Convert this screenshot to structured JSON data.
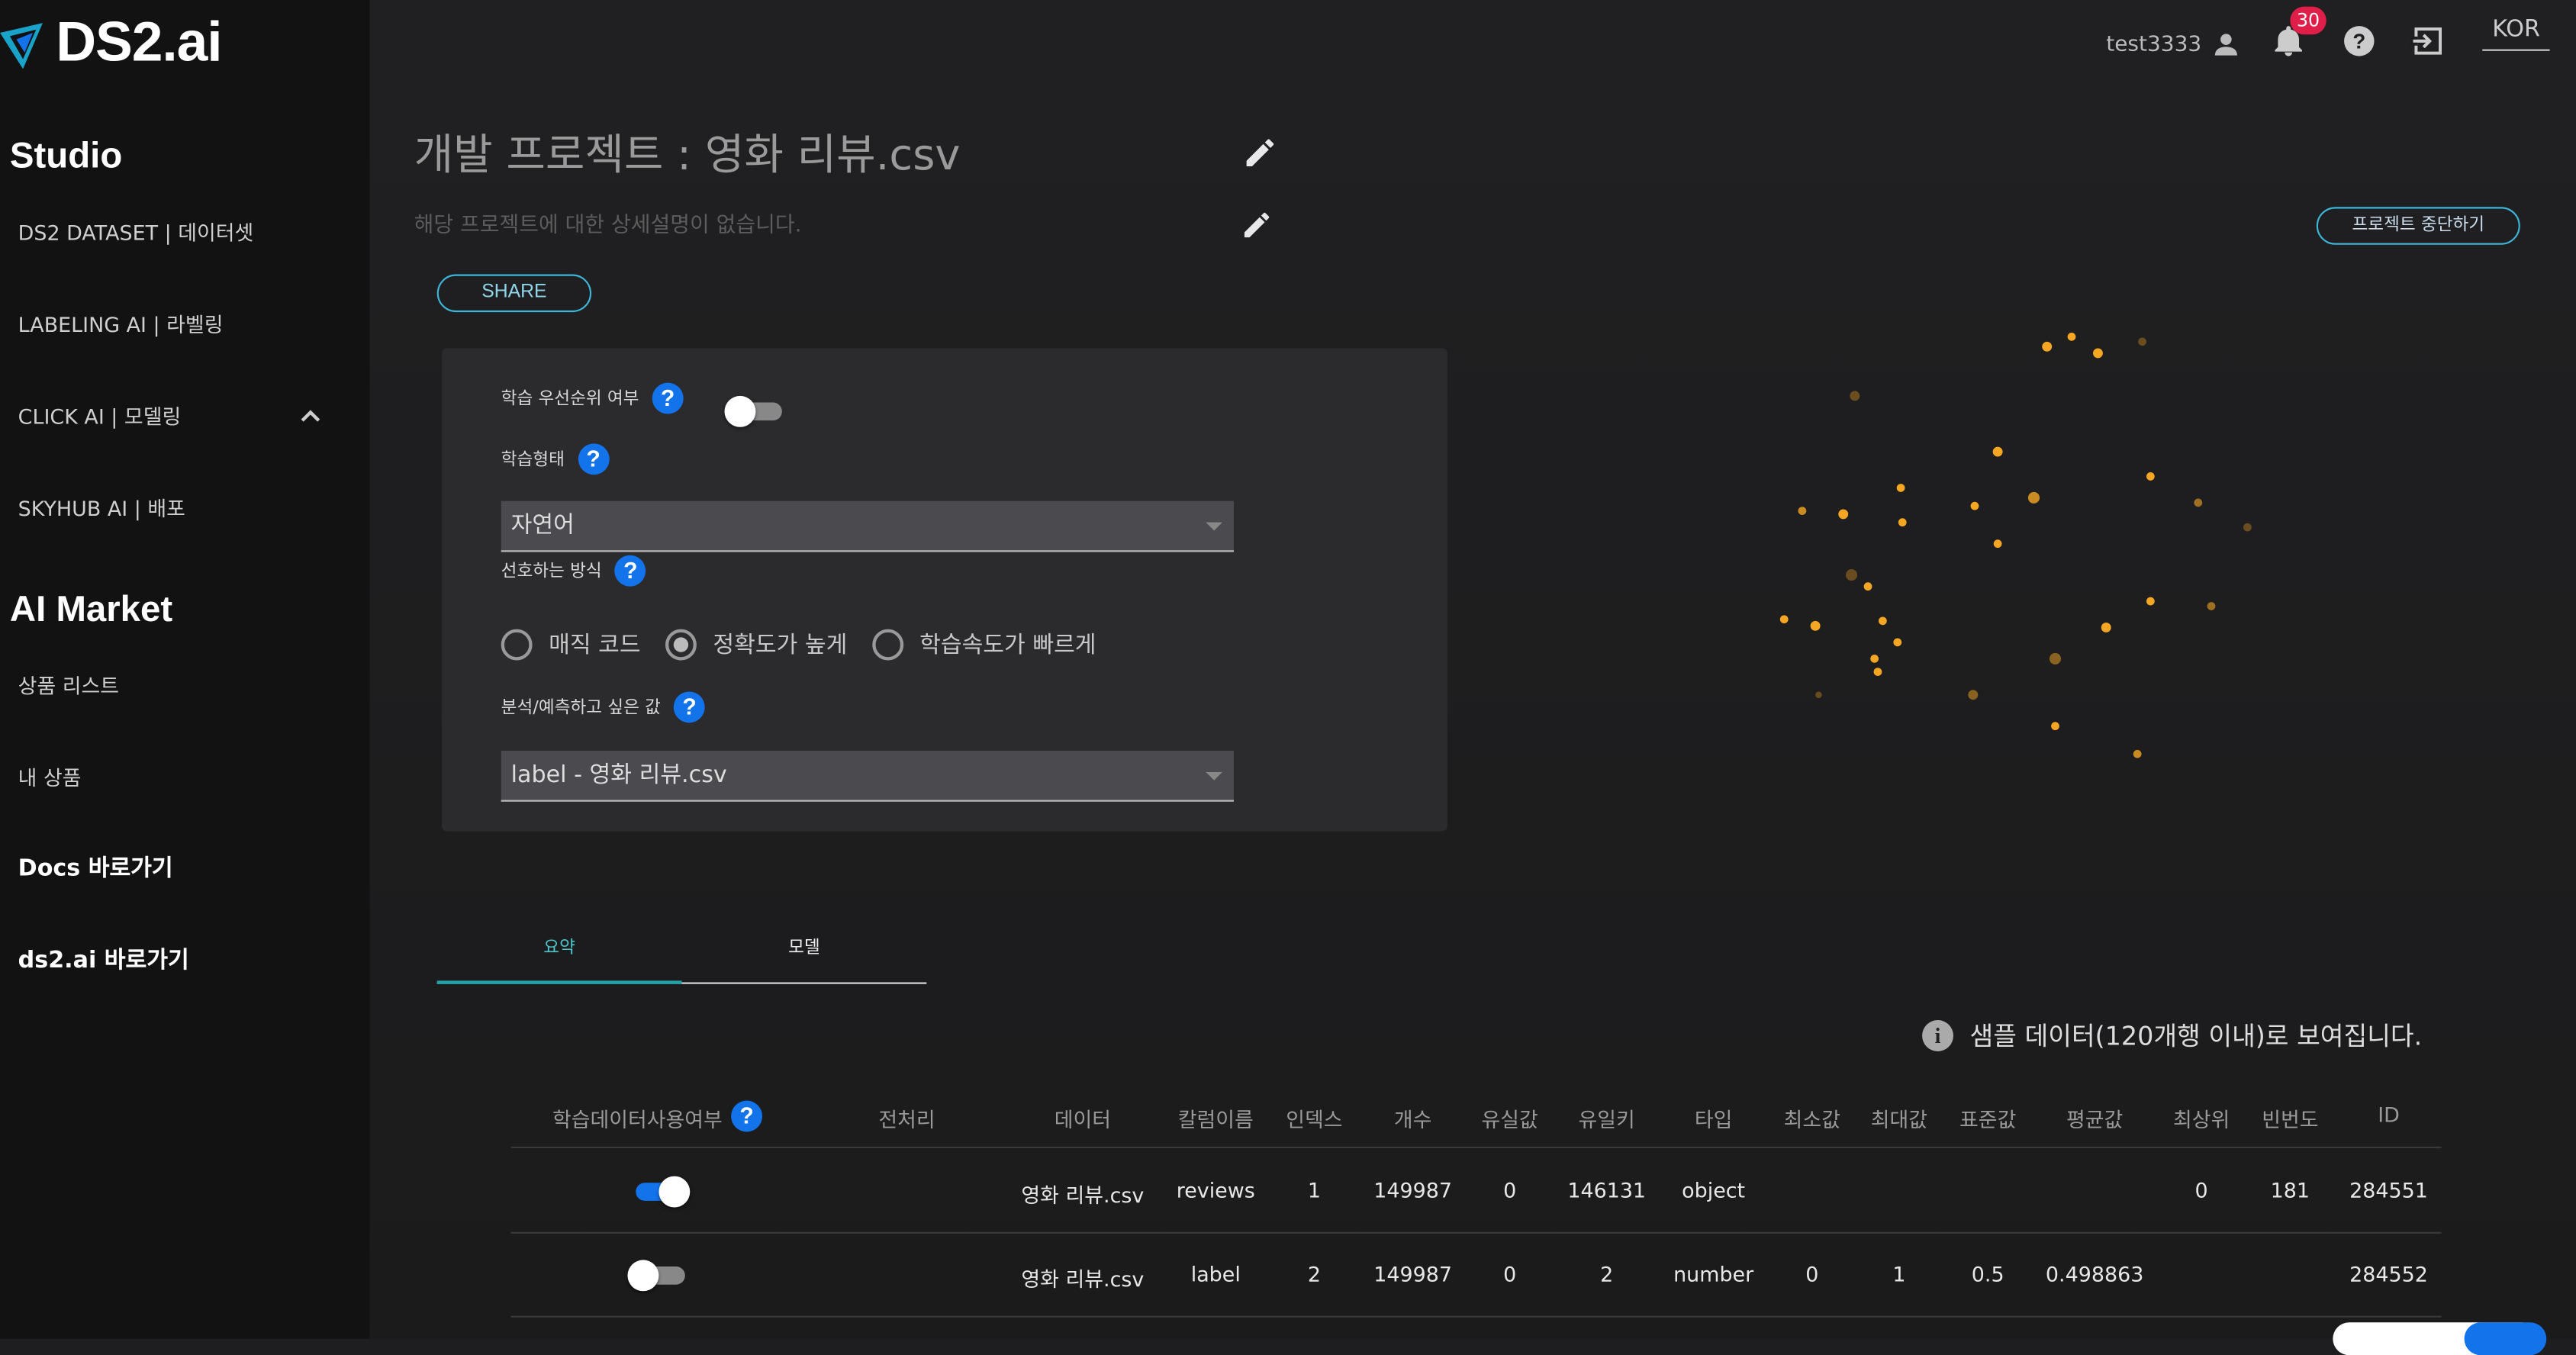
{
  "logo": {
    "text": "DS2.ai"
  },
  "sidebar": {
    "studio_title": "Studio",
    "studio_items": [
      {
        "label": "DS2 DATASET | 데이터셋"
      },
      {
        "label": "LABELING AI | 라벨링"
      },
      {
        "label": "CLICK AI | 모델링"
      },
      {
        "label": "SKYHUB AI | 배포"
      }
    ],
    "market_title": "AI Market",
    "market_items": [
      {
        "label": "상품 리스트"
      },
      {
        "label": "내 상품"
      }
    ],
    "links": [
      {
        "label": "Docs 바로가기"
      },
      {
        "label": "ds2.ai 바로가기"
      }
    ]
  },
  "header": {
    "username": "test3333",
    "notification_count": "30",
    "language": "KOR"
  },
  "project": {
    "title": "개발 프로젝트 : 영화 리뷰.csv",
    "description": "해당 프로젝트에 대한 상세설명이 없습니다.",
    "share_label": "SHARE",
    "stop_label": "프로젝트 중단하기"
  },
  "settings": {
    "priority_label": "학습 우선순위 여부",
    "priority_enabled": false,
    "train_type_label": "학습형태",
    "train_type_value": "자연어",
    "method_label": "선호하는 방식",
    "methods": [
      {
        "label": "매직 코드",
        "selected": false
      },
      {
        "label": "정확도가 높게",
        "selected": true
      },
      {
        "label": "학습속도가 빠르게",
        "selected": false
      }
    ],
    "target_label": "분석/예측하고 싶은 값",
    "target_value": "label - 영화 리뷰.csv",
    "help_glyph": "?"
  },
  "tabs": [
    {
      "label": "요약",
      "active": true
    },
    {
      "label": "모델",
      "active": false
    }
  ],
  "notice": {
    "text": "샘플 데이터(120개행 이내)로 보여집니다.",
    "icon_glyph": "i"
  },
  "table": {
    "headers": [
      "학습데이터사용여부",
      "전처리",
      "데이터",
      "칼럼이름",
      "인덱스",
      "개수",
      "유실값",
      "유일키",
      "타입",
      "최소값",
      "최대값",
      "표준값",
      "평균값",
      "최상위",
      "빈번도",
      "ID"
    ],
    "rows": [
      {
        "use": true,
        "preprocess": "",
        "data": "영화 리뷰.csv",
        "column": "reviews",
        "index": "1",
        "count": "149987",
        "missing": "0",
        "unique": "146131",
        "type": "object",
        "min": "",
        "max": "",
        "std": "",
        "mean": "",
        "top": "0",
        "freq": "181",
        "id": "284551"
      },
      {
        "use": false,
        "preprocess": "",
        "data": "영화 리뷰.csv",
        "column": "label",
        "index": "2",
        "count": "149987",
        "missing": "0",
        "unique": "2",
        "type": "number",
        "min": "0",
        "max": "1",
        "std": "0.5",
        "mean": "0.498863",
        "top": "",
        "freq": "",
        "id": "284552"
      }
    ]
  },
  "colors": {
    "accent": "#3db6d9",
    "toggle_on": "#1273eb",
    "badge": "#e01e4a",
    "dots": "#f5a623",
    "tab_active": "#1fa3a8"
  }
}
